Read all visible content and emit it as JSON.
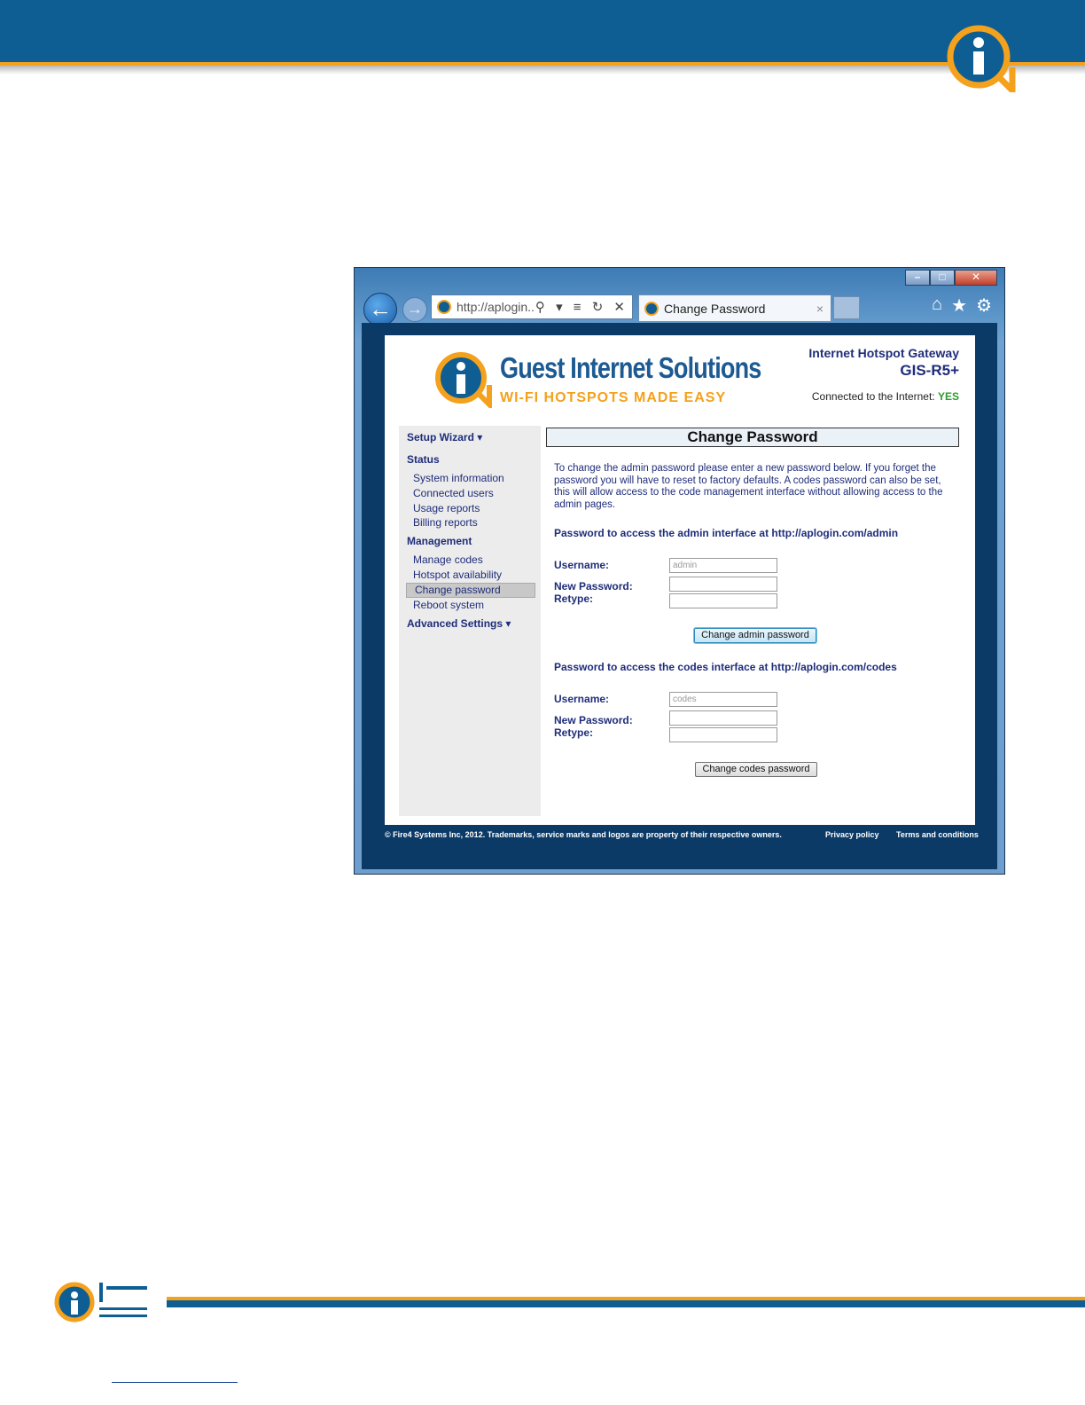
{
  "browser": {
    "address": "http://aplogin....",
    "tab_title": "Change Password",
    "tab_close": "×",
    "address_icons": "⚲ ▾ ≡ ↻ ✕"
  },
  "page": {
    "brand_name": "Guest Internet Solutions",
    "brand_tagline": "WI-FI HOTSPOTS MADE EASY",
    "product_name": "Internet Hotspot Gateway",
    "product_model": "GIS-R5+",
    "connection_label": "Connected to the Internet:",
    "connection_value": "YES",
    "sidebar": {
      "setup_wizard": "Setup Wizard ▾",
      "status": "Status",
      "system_information": "System information",
      "connected_users": "Connected users",
      "usage_reports": "Usage reports",
      "billing_reports": "Billing reports",
      "management": "Management",
      "manage_codes": "Manage codes",
      "hotspot_availability": "Hotspot availability",
      "change_password": "Change password",
      "reboot_system": "Reboot system",
      "advanced_settings": "Advanced Settings ▾"
    },
    "title": "Change Password",
    "intro": "To change the admin password please enter a new password below. If you forget the password you will have to reset to factory defaults. A codes password can also be set, this will allow access to the code management interface without allowing access to the admin pages.",
    "admin": {
      "heading": "Password to access the admin interface at http://aplogin.com/admin",
      "username_label": "Username:",
      "username_value": "admin",
      "new_password_label": "New Password:",
      "retype_label": "Retype:",
      "button": "Change admin password"
    },
    "codes": {
      "heading": "Password to access the codes interface at http://aplogin.com/codes",
      "username_label": "Username:",
      "username_value": "codes",
      "new_password_label": "New Password:",
      "retype_label": "Retype:",
      "button": "Change codes password"
    },
    "footer": {
      "copyright": "© Fire4 Systems Inc, 2012. Trademarks, service marks and logos are property of their respective owners.",
      "privacy": "Privacy policy",
      "terms": "Terms and conditions"
    }
  },
  "colors": {
    "doc_blue": "#0e5e93",
    "doc_orange": "#f4a11d",
    "nav_text": "#1f2d7a",
    "status_yes": "#2e9a2e"
  }
}
